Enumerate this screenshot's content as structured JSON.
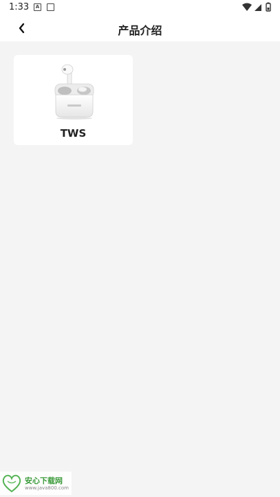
{
  "status_bar": {
    "time": "1:33",
    "notification_icons": [
      "a-notification-icon",
      "screenshot-notification-icon"
    ],
    "system_icons": [
      "wifi-icon",
      "cell-signal-icon",
      "battery-icon"
    ]
  },
  "header": {
    "title": "产品介绍",
    "back_icon": "chevron-left-icon"
  },
  "products": [
    {
      "name": "TWS",
      "image": "earbuds-case-image"
    }
  ],
  "watermark": {
    "title": "安心下载网",
    "url": "www.java800.com"
  },
  "colors": {
    "background": "#f4f4f4",
    "card": "#ffffff",
    "text": "#222222",
    "watermark_green": "#3a9a3a"
  }
}
